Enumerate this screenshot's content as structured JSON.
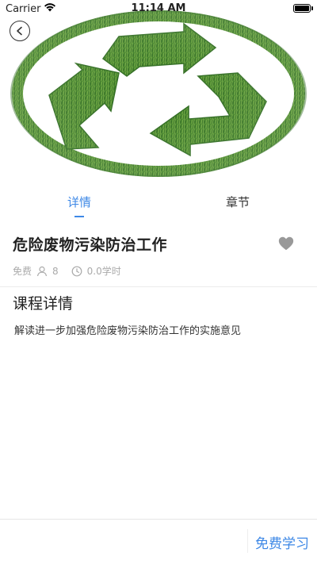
{
  "status_bar": {
    "carrier": "Carrier",
    "time": "11:14 AM",
    "wifi_icon": "wifi-icon",
    "battery_icon": "battery-icon"
  },
  "hero": {
    "image_icon": "recycling-symbol-grass",
    "colors": {
      "grass_dark": "#2e6b1f",
      "grass_mid": "#4f8f2c",
      "grass_light": "#7fb34a"
    }
  },
  "nav": {
    "back_icon": "chevron-left-icon"
  },
  "tabs": [
    {
      "label": "详情",
      "active": true
    },
    {
      "label": "章节",
      "active": false
    }
  ],
  "course": {
    "title": "危险废物污染防治工作",
    "favorite_icon": "heart-icon",
    "price_label": "免费",
    "learners_icon": "person-icon",
    "learners": "8",
    "hours_icon": "clock-icon",
    "hours": "0.0学时"
  },
  "detail": {
    "heading": "课程详情",
    "body": "解读进一步加强危险废物污染防治工作的实施意见"
  },
  "bottom_bar": {
    "enroll_label": "免费学习"
  },
  "colors": {
    "accent": "#3e88e6",
    "muted": "#aaaaaa",
    "heart": "#999999"
  }
}
